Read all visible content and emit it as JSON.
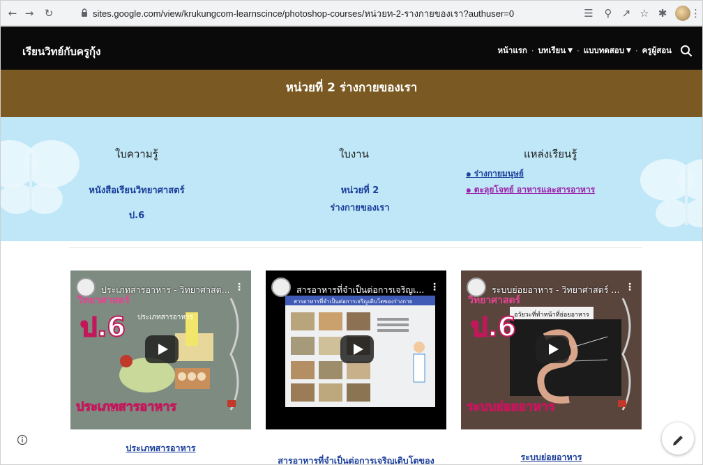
{
  "browser": {
    "url": "sites.google.com/view/krukungcom-learnscince/photoshop-courses/หน่วยท-2-รางกายของเรา?authuser=0",
    "icons": [
      "back-icon",
      "forward-icon",
      "reload-icon",
      "lock-icon",
      "translate-icon",
      "zoom-icon",
      "share-icon",
      "star-icon",
      "extensions-icon",
      "profile-avatar",
      "menu-icon"
    ]
  },
  "site": {
    "title": "เรียนวิทย์กับครูกุ้ง",
    "nav": [
      {
        "label": "หน้าแรก",
        "dropdown": false
      },
      {
        "label": "บทเรียน",
        "dropdown": true
      },
      {
        "label": "แบบทดสอบ",
        "dropdown": true
      },
      {
        "label": "ครูผู้สอน",
        "dropdown": false
      }
    ]
  },
  "banner": {
    "title": "หน่วยที่ 2  ร่างกายของเรา",
    "color": "#7a5a22"
  },
  "panel": {
    "color": "#bfe7f7",
    "knowledge": {
      "title": "ใบความรู้",
      "line1": "หนังสือเรียนวิทยาศาสตร์",
      "line2": "ป.6"
    },
    "worksheet": {
      "title": "ใบงาน",
      "line1": "หน่วยที่ 2",
      "line2": "ร่างกายของเรา"
    },
    "resources": {
      "title": "แหล่งเรียนรู้",
      "links": [
        "๑ ร่างกายมนุษย์",
        "๑ ตะลุยโจทย์ อาหารและสารอาหาร"
      ]
    }
  },
  "videos": [
    {
      "title": "ประเภทสารอาหาร - วิทยาศาสต...",
      "caption": "ประเภทสารอาหาร"
    },
    {
      "title": "สารอาหารที่จำเป็นต่อการเจริญเ...",
      "caption": "สารอาหารที่จำเป็นต่อการเจริญเติบโตของ"
    },
    {
      "title": "ระบบย่อยอาหาร - วิทยาศาสตร์ ...",
      "caption": "ระบบย่อยอาหาร"
    }
  ],
  "thumb_text": {
    "grade": "ป.6",
    "v1_title": "ประเภทสารอาหาร",
    "v1_bottom": "ประเภทสารอาหาร",
    "v2_header": "สารอาหารที่จำเป็นต่อการเจริญเติบโตของร่างกาย",
    "v3_heading": "อวัยวะที่ทำหน้าที่ย่อยอาหาร",
    "v3_bottom": "ระบบย่อยอาหาร"
  },
  "colors": {
    "link_blue": "#1a3d9a",
    "link_purple": "#9b1fa8",
    "header_black": "#0a0a0a"
  }
}
